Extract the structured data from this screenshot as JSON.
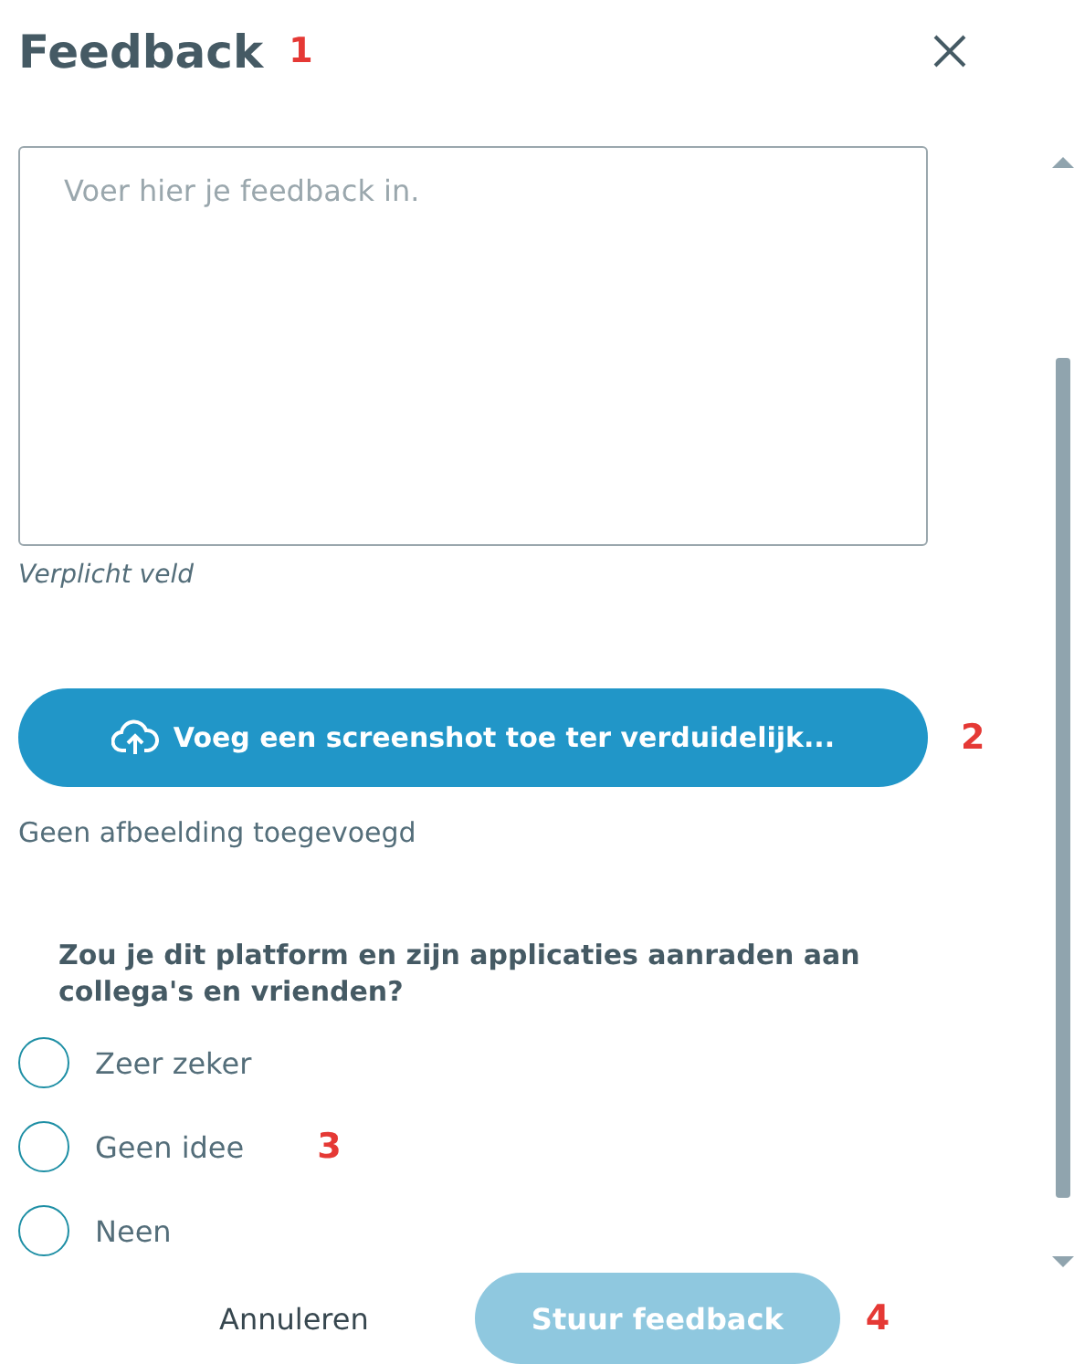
{
  "title": "Feedback",
  "annotations": [
    "1",
    "2",
    "3",
    "4"
  ],
  "feedback_field": {
    "placeholder": "Voer hier je feedback in.",
    "hint": "Verplicht veld"
  },
  "upload_button": {
    "label": "Voeg een screenshot toe ter verduidelijk..."
  },
  "upload_status": "Geen afbeelding toegevoegd",
  "question": "Zou je dit platform en zijn applicaties aanraden aan collega's en vrienden?",
  "options": [
    {
      "label": "Zeer zeker",
      "selected": false
    },
    {
      "label": "Geen idee",
      "selected": false
    },
    {
      "label": "Neen",
      "selected": false
    }
  ],
  "cancel_button": "Annuleren",
  "submit_button": {
    "label": "Stuur feedback",
    "disabled": true
  }
}
